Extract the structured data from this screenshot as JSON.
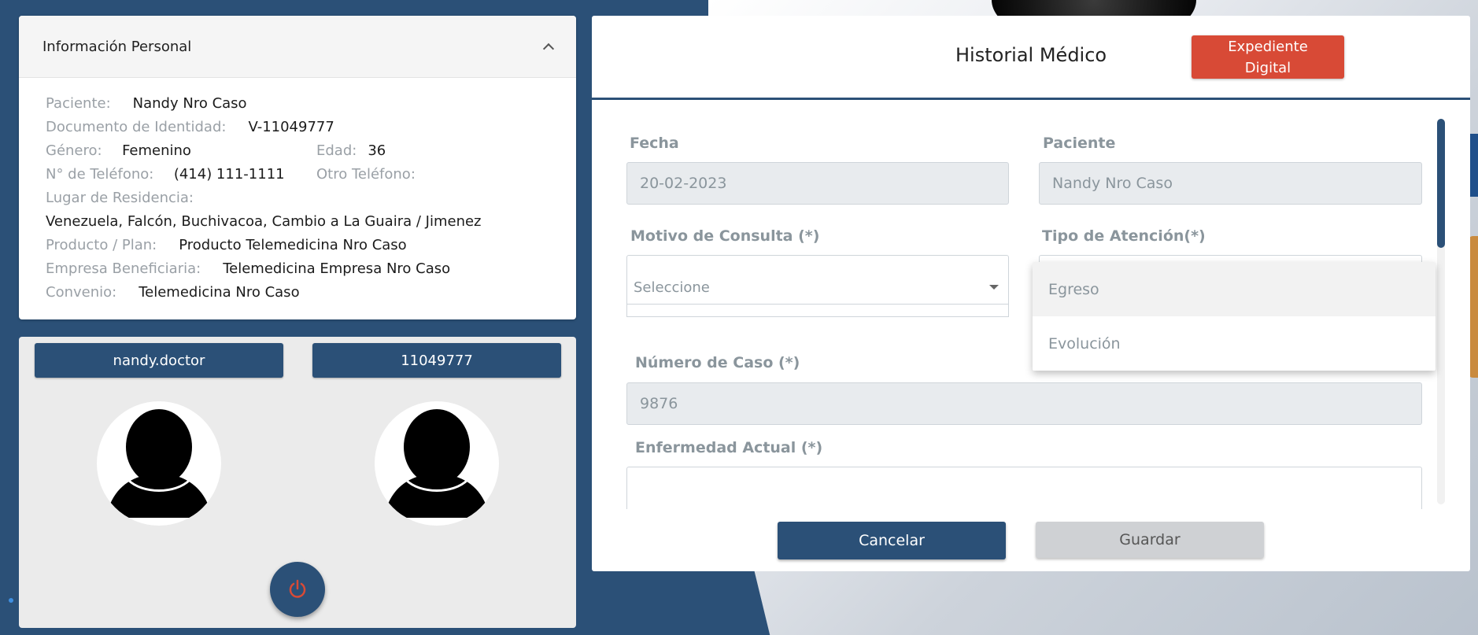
{
  "personal": {
    "title": "Información Personal",
    "patient_label": "Paciente:",
    "patient_value": "Nandy Nro Caso",
    "doc_label": "Documento de Identidad:",
    "doc_value": "V-11049777",
    "gender_label": "Género:",
    "gender_value": "Femenino",
    "age_label": "Edad:",
    "age_value": "36",
    "phone_label": "N° de Teléfono:",
    "phone_value": "(414) 111-1111",
    "other_phone_label": "Otro Teléfono:",
    "other_phone_value": "",
    "residence_label": "Lugar de Residencia:",
    "residence_value": "Venezuela, Falcón, Buchivacoa, Cambio a La Guaira / Jimenez",
    "plan_label": "Producto / Plan:",
    "plan_value": "Producto Telemedicina Nro Caso",
    "company_label": "Empresa Beneficiaria:",
    "company_value": "Telemedicina Empresa Nro Caso",
    "agreement_label": "Convenio:",
    "agreement_value": "Telemedicina Nro Caso"
  },
  "video": {
    "doctor_name": "nandy.doctor",
    "patient_id": "11049777",
    "avatar_icon": "user-silhouette-icon",
    "power_icon": "power-icon",
    "power_color": "#d84a36"
  },
  "history": {
    "title": "Historial Médico",
    "digital_record_button": "Expediente Digital",
    "fecha_label": "Fecha",
    "fecha_value": "20-02-2023",
    "paciente_label": "Paciente",
    "paciente_value": "Nandy Nro Caso",
    "motivo_label": "Motivo de Consulta (*)",
    "motivo_placeholder": "Seleccione",
    "tipo_label": "Tipo de Atención(*)",
    "caso_label": "Número de Caso (*)",
    "caso_value": "9876",
    "enfermedad_label": "Enfermedad Actual (*)",
    "cancel_button": "Cancelar",
    "save_button": "Guardar"
  },
  "tipo_dropdown": {
    "options": [
      "Egreso",
      "Evolución"
    ]
  },
  "colors": {
    "primary": "#2b5077",
    "accent": "#d84a36"
  }
}
